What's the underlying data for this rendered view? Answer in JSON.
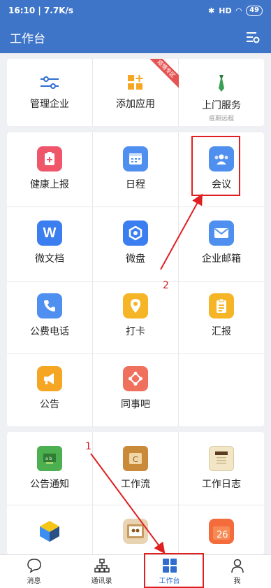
{
  "status": {
    "time": "16:10 | 7.7K/s",
    "signal": "HD",
    "battery": "49"
  },
  "header": {
    "title": "工作台"
  },
  "top_card": {
    "items": [
      {
        "label": "管理企业"
      },
      {
        "label": "添加应用",
        "ribbon": "疫情专区"
      },
      {
        "label": "上门服务",
        "sub": "疫期远程"
      }
    ]
  },
  "apps": [
    {
      "label": "健康上报",
      "color": "#f0566a"
    },
    {
      "label": "日程",
      "color": "#4f8ff0"
    },
    {
      "label": "会议",
      "color": "#4f8ff0"
    },
    {
      "label": "微文档",
      "color": "#3a7ef0"
    },
    {
      "label": "微盘",
      "color": "#3a7ef0"
    },
    {
      "label": "企业邮箱",
      "color": "#4f8ff0"
    },
    {
      "label": "公费电话",
      "color": "#4f8ff0"
    },
    {
      "label": "打卡",
      "color": "#f5b526"
    },
    {
      "label": "汇报",
      "color": "#f5b526"
    },
    {
      "label": "公告",
      "color": "#f5a623"
    },
    {
      "label": "同事吧",
      "color": "#f0705e"
    }
  ],
  "more_apps": [
    {
      "label": "公告通知",
      "color": "#4caf50"
    },
    {
      "label": "工作流",
      "color": "#c98a3a"
    },
    {
      "label": "工作日志",
      "color": "#f2e6c7"
    }
  ],
  "nav": [
    {
      "label": "消息"
    },
    {
      "label": "通讯录"
    },
    {
      "label": "工作台"
    },
    {
      "label": "我"
    }
  ],
  "annotations": {
    "step1": "1",
    "step2": "2"
  }
}
